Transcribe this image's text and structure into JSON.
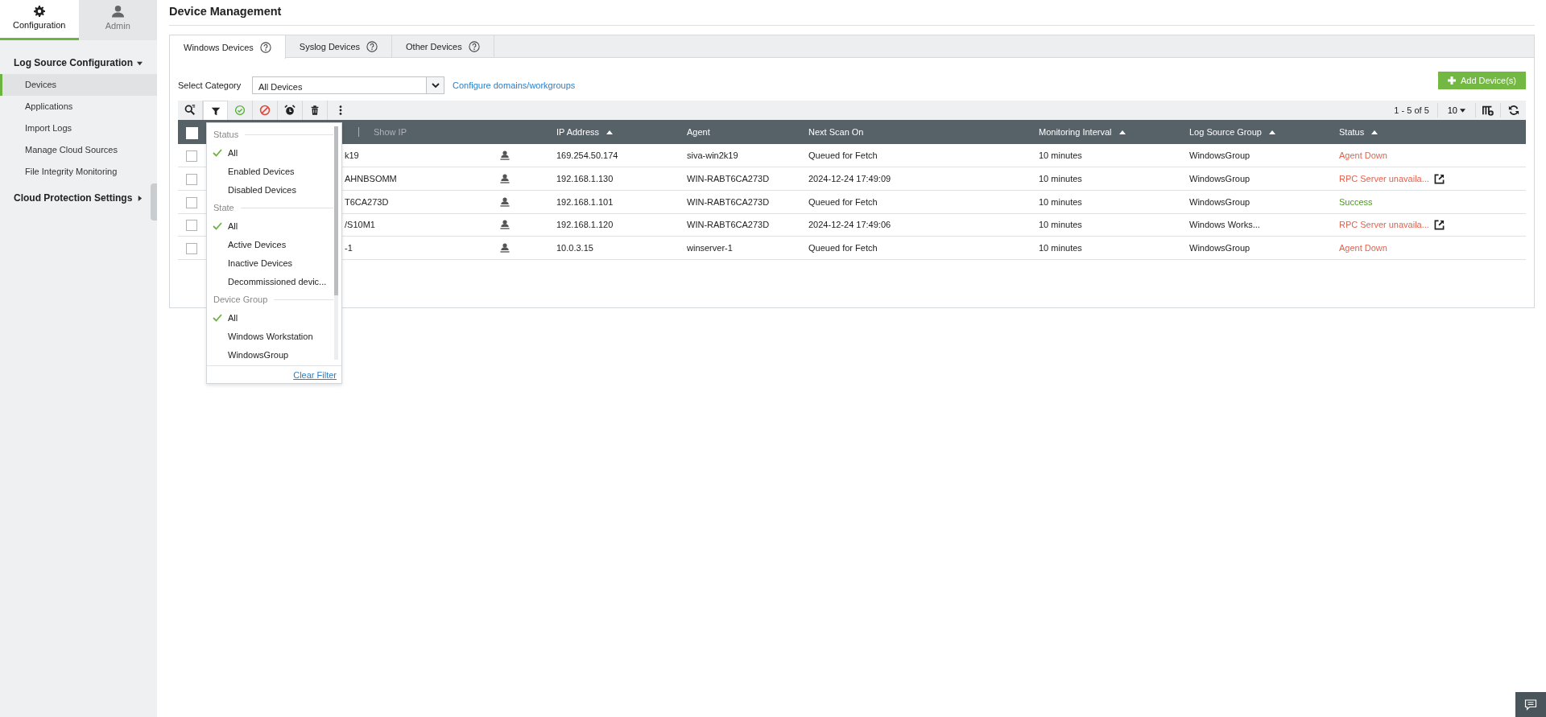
{
  "sidebar": {
    "tabs": [
      {
        "label": "Configuration",
        "selected": true
      },
      {
        "label": "Admin",
        "selected": false
      }
    ],
    "sections": [
      {
        "label": "Log Source Configuration",
        "expanded": true,
        "items": [
          {
            "label": "Devices",
            "selected": true
          },
          {
            "label": "Applications",
            "selected": false
          },
          {
            "label": "Import Logs",
            "selected": false
          },
          {
            "label": "Manage Cloud Sources",
            "selected": false
          },
          {
            "label": "File Integrity Monitoring",
            "selected": false
          }
        ]
      },
      {
        "label": "Cloud Protection Settings",
        "expanded": false
      }
    ]
  },
  "page_title": "Device Management",
  "tabs": [
    {
      "label": "Windows Devices",
      "selected": true
    },
    {
      "label": "Syslog Devices",
      "selected": false
    },
    {
      "label": "Other Devices",
      "selected": false
    }
  ],
  "category": {
    "label": "Select Category",
    "value": "All Devices"
  },
  "configure_link": "Configure domains/workgroups",
  "add_button": "Add Device(s)",
  "pagination": {
    "range": "1 - 5 of 5",
    "page_size": "10"
  },
  "table": {
    "all_checked": false,
    "show_ip": "Show IP",
    "columns": [
      {
        "label": "IP Address",
        "sortable": true
      },
      {
        "label": "Agent",
        "sortable": false
      },
      {
        "label": "Next Scan On",
        "sortable": false
      },
      {
        "label": "Monitoring Interval",
        "sortable": true
      },
      {
        "label": "Log Source Group",
        "sortable": true
      },
      {
        "label": "Status",
        "sortable": true
      }
    ],
    "rows": [
      {
        "checked": false,
        "device": "k19",
        "ip": "169.254.50.174",
        "agent": "siva-win2k19",
        "next_scan": "Queued for Fetch",
        "interval": "10 minutes",
        "group": "WindowsGroup",
        "status": "Agent Down",
        "color": "#e8604c",
        "details_link": false
      },
      {
        "checked": false,
        "device": "AHNBSOMM",
        "ip": "192.168.1.130",
        "agent": "WIN-RABT6CA273D",
        "next_scan": "2024-12-24 17:49:09",
        "interval": "10 minutes",
        "group": "WindowsGroup",
        "status": "RPC Server unavaila...",
        "color": "#e8604c",
        "details_link": true
      },
      {
        "checked": false,
        "device": "T6CA273D",
        "ip": "192.168.1.101",
        "agent": "WIN-RABT6CA273D",
        "next_scan": "Queued for Fetch",
        "interval": "10 minutes",
        "group": "WindowsGroup",
        "status": "Success",
        "color": "#4a9a1e",
        "details_link": false
      },
      {
        "checked": false,
        "device": "/S10M1",
        "ip": "192.168.1.120",
        "agent": "WIN-RABT6CA273D",
        "next_scan": "2024-12-24 17:49:06",
        "interval": "10 minutes",
        "group": "Windows Works...",
        "status": "RPC Server unavaila...",
        "color": "#e8604c",
        "details_link": true
      },
      {
        "checked": false,
        "device": "-1",
        "ip": "10.0.3.15",
        "agent": "winserver-1",
        "next_scan": "Queued for Fetch",
        "interval": "10 minutes",
        "group": "WindowsGroup",
        "status": "Agent Down",
        "color": "#e8604c",
        "details_link": false
      }
    ]
  },
  "filter_menu": {
    "sections": [
      {
        "title": "Status",
        "options": [
          {
            "label": "All",
            "checked": true
          },
          {
            "label": "Enabled Devices",
            "checked": false
          },
          {
            "label": "Disabled Devices",
            "checked": false
          }
        ]
      },
      {
        "title": "State",
        "options": [
          {
            "label": "All",
            "checked": true
          },
          {
            "label": "Active Devices",
            "checked": false
          },
          {
            "label": "Inactive Devices",
            "checked": false
          },
          {
            "label": "Decommissioned devic...",
            "checked": false
          }
        ]
      },
      {
        "title": "Device Group",
        "options": [
          {
            "label": "All",
            "checked": true
          },
          {
            "label": "Windows Workstation",
            "checked": false
          },
          {
            "label": "WindowsGroup",
            "checked": false
          }
        ]
      }
    ],
    "clear": "Clear Filter"
  }
}
